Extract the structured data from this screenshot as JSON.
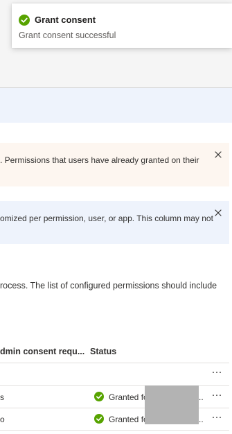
{
  "toast": {
    "icon": "checkmark-circle-icon",
    "title": "Grant consent",
    "message": "Grant consent successful"
  },
  "banners": {
    "warning_text": ". Permissions that users have already granted on their",
    "info_text": "omized per permission, user, or app. This column may not"
  },
  "description": "rocess. The list of configured permissions should include",
  "table": {
    "headers": {
      "admin_consent": "dmin consent requ...",
      "status": "Status"
    },
    "rows": [
      {
        "left": "",
        "status": ""
      },
      {
        "left": "s",
        "status": "Granted fo",
        "status_suffix": ".."
      },
      {
        "left": "o",
        "status": "Granted fo",
        "status_suffix": ".."
      }
    ],
    "more_label": "···"
  },
  "colors": {
    "success": "#57a300",
    "warning_bg": "#fdf6f0",
    "info_bg": "#eef3fc"
  }
}
